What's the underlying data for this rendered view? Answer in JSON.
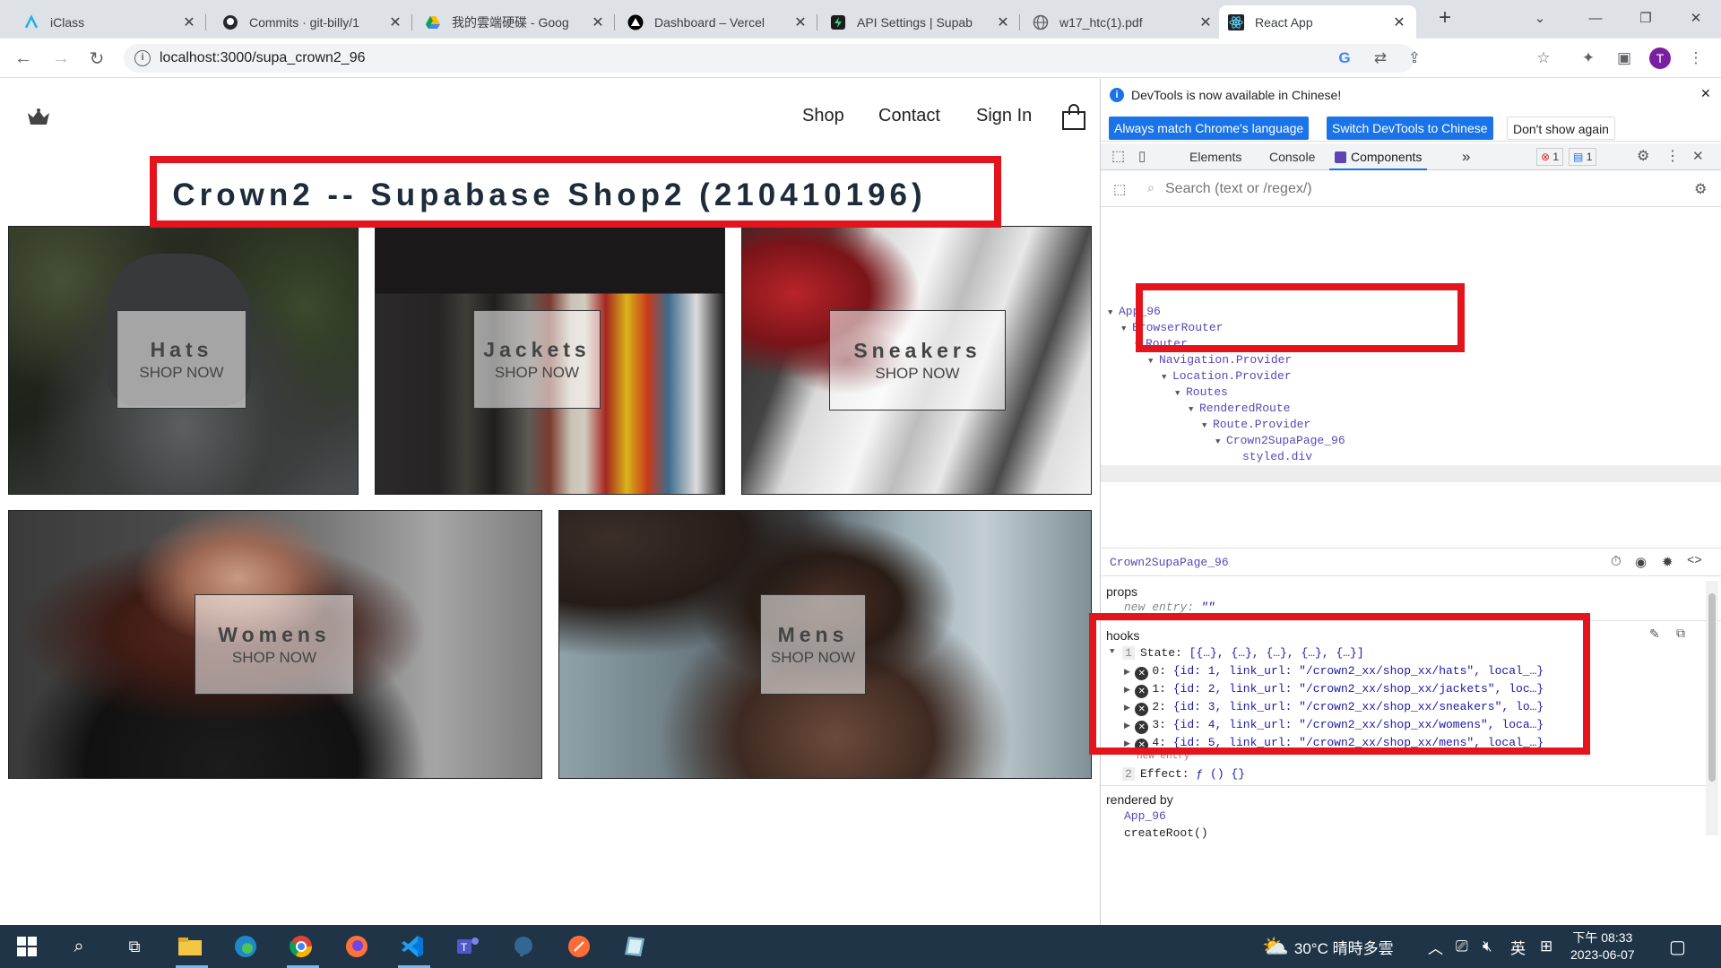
{
  "tabs": [
    {
      "label": "iClass",
      "icon": "iclass-icon"
    },
    {
      "label": "Commits · git-billy/1",
      "icon": "github-icon"
    },
    {
      "label": "我的雲端硬碟 - Goog",
      "icon": "google-drive-icon"
    },
    {
      "label": "Dashboard – Vercel",
      "icon": "vercel-icon"
    },
    {
      "label": "API Settings | Supab",
      "icon": "supabase-icon"
    },
    {
      "label": "w17_htc(1).pdf",
      "icon": "globe-icon"
    },
    {
      "label": "React App",
      "icon": "react-icon"
    }
  ],
  "toolbar": {
    "url": "localhost:3000/supa_crown2_96",
    "profile_initial": "T"
  },
  "page": {
    "nav": {
      "shop": "Shop",
      "contact": "Contact",
      "signin": "Sign In"
    },
    "title": "Crown2 -- Supabase Shop2 (210410196)",
    "categories": [
      {
        "title": "Hats",
        "subtitle": "SHOP NOW"
      },
      {
        "title": "Jackets",
        "subtitle": "SHOP NOW"
      },
      {
        "title": "Sneakers",
        "subtitle": "SHOP NOW"
      },
      {
        "title": "Womens",
        "subtitle": "SHOP NOW"
      },
      {
        "title": "Mens",
        "subtitle": "SHOP NOW"
      }
    ]
  },
  "devtools": {
    "infobar": {
      "message": "DevTools is now available in Chinese!",
      "btn_match": "Always match Chrome's language",
      "btn_switch": "Switch DevTools to Chinese",
      "btn_dont": "Don't show again"
    },
    "tabs": {
      "elements": "Elements",
      "console": "Console",
      "components": "Components",
      "more": "»",
      "errors": "1",
      "messages": "1"
    },
    "search_placeholder": "Search (text or /regex/)",
    "tree": [
      "App_96",
      "BrowserRouter",
      "Router",
      "Navigation.Provider",
      "Location.Provider",
      "Routes",
      "RenderedRoute",
      "Route.Provider",
      "Crown2SupaPage_96",
      "styled.div"
    ],
    "inspector": {
      "component": "Crown2SupaPage_96",
      "props_label": "props",
      "props_key": "new entry",
      "props_value": "\"\"",
      "hooks_label": "hooks",
      "state_index": "1",
      "state_label": "State:",
      "state_value": "[{…}, {…}, {…}, {…}, {…}]",
      "items": [
        {
          "idx": "0:",
          "text": "{id: 1, link_url: \"/crown2_xx/shop_xx/hats\", local_…}"
        },
        {
          "idx": "1:",
          "text": "{id: 2, link_url: \"/crown2_xx/shop_xx/jackets\", loc…}"
        },
        {
          "idx": "2:",
          "text": "{id: 3, link_url: \"/crown2_xx/shop_xx/sneakers\", lo…}"
        },
        {
          "idx": "3:",
          "text": "{id: 4, link_url: \"/crown2_xx/shop_xx/womens\", loca…}"
        },
        {
          "idx": "4:",
          "text": "{id: 5, link_url: \"/crown2_xx/shop_xx/mens\", local_…}"
        }
      ],
      "new_entry": "new entry",
      "effect_index": "2",
      "effect_label": "Effect:",
      "effect_value": "ƒ () {}",
      "rendered_by_label": "rendered by",
      "rendered_by": [
        "App_96",
        "createRoot()"
      ]
    }
  },
  "taskbar": {
    "weather": "30°C 晴時多雲",
    "ime": "英",
    "time": "下午 08:33",
    "date": "2023-06-07"
  },
  "colors": {
    "highlight": "#e3141c",
    "accent": "#1a73e8",
    "taskbar": "#203447"
  }
}
